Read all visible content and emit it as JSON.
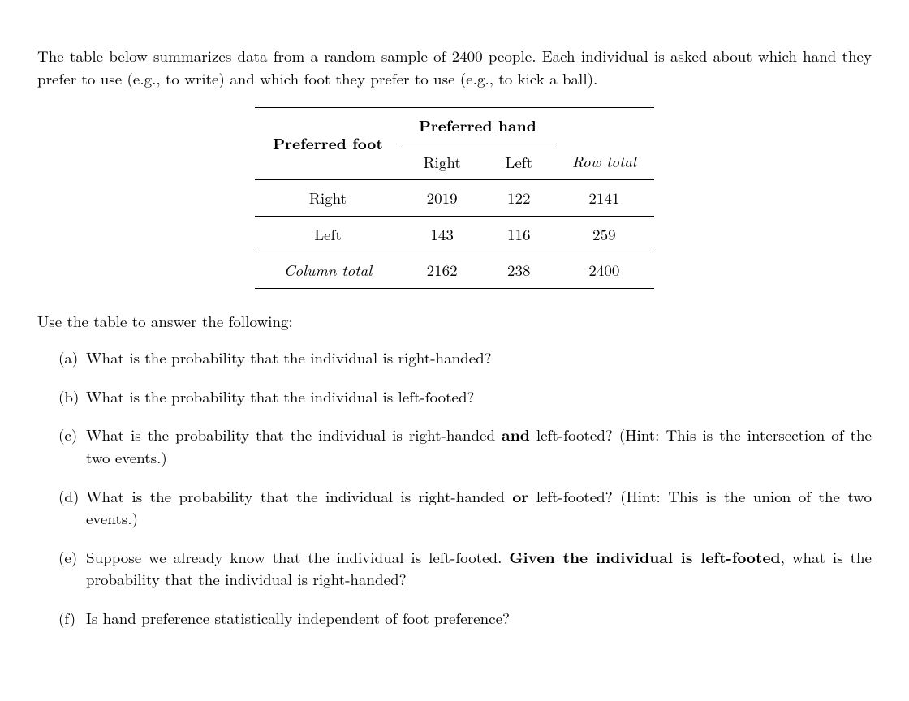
{
  "intro": "The table below summarizes data from a random sample of 2400 people. Each individual is asked about which hand they prefer to use (e.g., to write) and which foot they prefer to use (e.g., to kick a ball).",
  "table": {
    "row_header_title": "Preferred foot",
    "col_header_title": "Preferred hand",
    "col_labels": [
      "Right",
      "Left"
    ],
    "row_total_label": "Row total",
    "col_total_label": "Column total",
    "rows": [
      {
        "label": "Right",
        "cells": [
          2019,
          122
        ],
        "total": 2141
      },
      {
        "label": "Left",
        "cells": [
          143,
          116
        ],
        "total": 259
      }
    ],
    "col_totals": [
      2162,
      238
    ],
    "grand_total": 2400
  },
  "prompt": "Use the table to answer the following:",
  "questions": {
    "a": {
      "marker": "(a)",
      "parts": [
        "What is the probability that the individual is right-handed?"
      ]
    },
    "b": {
      "marker": "(b)",
      "parts": [
        "What is the probability that the individual is left-footed?"
      ]
    },
    "c": {
      "marker": "(c)",
      "parts": [
        "What is the probability that the individual is right-handed ",
        "and",
        " left-footed? (Hint: This is the intersection of the two events.)"
      ]
    },
    "d": {
      "marker": "(d)",
      "parts": [
        "What is the probability that the individual is right-handed ",
        "or",
        " left-footed? (Hint: This is the union of the two events.)"
      ]
    },
    "e": {
      "marker": "(e)",
      "parts": [
        "Suppose we already know that the individual is left-footed. ",
        "Given the individual is left-footed",
        ", what is the probability that the individual is right-handed?"
      ]
    },
    "f": {
      "marker": "(f)",
      "parts": [
        "Is hand preference statistically independent of foot preference?"
      ]
    }
  }
}
